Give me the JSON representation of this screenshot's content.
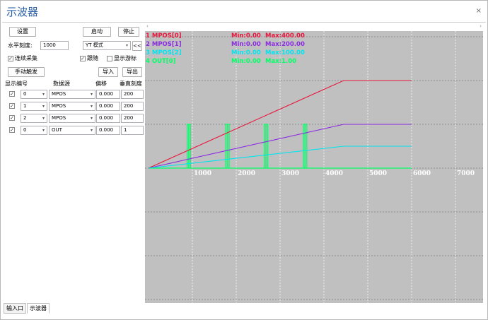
{
  "window": {
    "title": "示波器",
    "close_glyph": "×"
  },
  "toolbar": {
    "settings_label": "设置",
    "start_label": "启动",
    "stop_label": "停止",
    "h_scale_label": "水平刻度:",
    "h_scale_value": "1000",
    "mode_value": "YT 模式",
    "collapse_label": "<<",
    "continuous_label": "连续采集",
    "follow_label": "跟随",
    "cursor_label": "显示游标",
    "manual_trigger_label": "手动触发",
    "import_label": "导入",
    "export_label": "导出"
  },
  "channel_table": {
    "headers": [
      "显示",
      "编号",
      "数据源",
      "偏移",
      "垂直刻度"
    ],
    "rows": [
      {
        "shown": true,
        "index": "0",
        "source": "MPOS",
        "offset": "0.000",
        "scale": "200"
      },
      {
        "shown": true,
        "index": "1",
        "source": "MPOS",
        "offset": "0.000",
        "scale": "200"
      },
      {
        "shown": true,
        "index": "2",
        "source": "MPOS",
        "offset": "0.000",
        "scale": "200"
      },
      {
        "shown": true,
        "index": "0",
        "source": "OUT",
        "offset": "0.000",
        "scale": "1"
      }
    ]
  },
  "tabs": [
    {
      "label": "输入口",
      "active": false
    },
    {
      "label": "示波器",
      "active": true
    }
  ],
  "scroll": {
    "left_arrow": "‹",
    "right_arrow": "›"
  },
  "chart_data": {
    "type": "line",
    "background": "#c0c0c0",
    "grid": true,
    "x_ticks": [
      "1000",
      "2000",
      "3000",
      "4000",
      "5000",
      "6000",
      "7000"
    ],
    "xlim": [
      0,
      7500
    ],
    "legend_placement": "top-left",
    "legend": [
      {
        "name": "1 MPOS[0]",
        "min": "Min:0.00",
        "max": "Max:400.00",
        "color": "#e8163c"
      },
      {
        "name": "2 MPOS[1]",
        "min": "Min:0.00",
        "max": "Max:200.00",
        "color": "#8a2be2"
      },
      {
        "name": "3 MPOS[2]",
        "min": "Min:0.00",
        "max": "Max:100.00",
        "color": "#00e5ee"
      },
      {
        "name": "4 OUT[0]",
        "min": "Min:0.00",
        "max": "Max:1.00",
        "color": "#00ff66"
      }
    ],
    "series": [
      {
        "name": "1 MPOS[0]",
        "color": "#e8163c",
        "x": [
          0,
          4450,
          6000
        ],
        "y": [
          0,
          400,
          400
        ]
      },
      {
        "name": "2 MPOS[1]",
        "color": "#8a2be2",
        "x": [
          0,
          4450,
          6000
        ],
        "y": [
          0,
          200,
          200
        ]
      },
      {
        "name": "3 MPOS[2]",
        "color": "#00e5ee",
        "x": [
          0,
          4450,
          6000
        ],
        "y": [
          0,
          100,
          100
        ]
      }
    ],
    "out_pulses": [
      [
        880,
        960
      ],
      [
        1760,
        1840
      ],
      [
        2640,
        2720
      ],
      [
        3530,
        3610
      ]
    ],
    "out_color": "#00ff66"
  }
}
